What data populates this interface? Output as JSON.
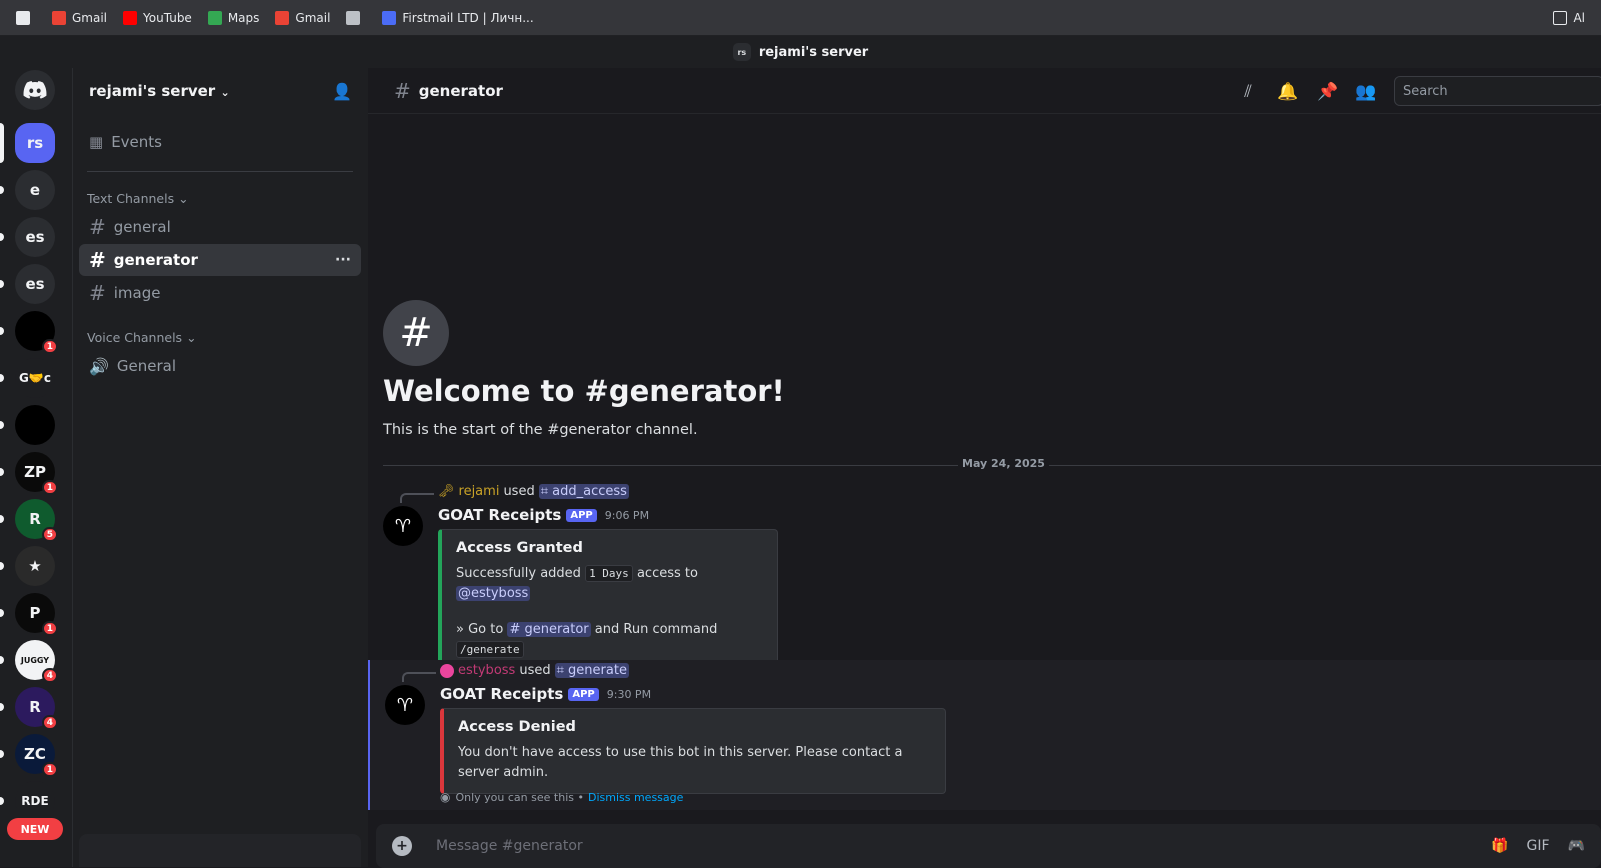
{
  "bookmarks": [
    {
      "label": "",
      "icon": "apps-grid-icon",
      "color": "#e8eaed"
    },
    {
      "label": "Gmail",
      "icon": "gmail-icon",
      "color": "#ea4335"
    },
    {
      "label": "YouTube",
      "icon": "youtube-icon",
      "color": "#ff0000"
    },
    {
      "label": "Maps",
      "icon": "maps-pin-icon",
      "color": "#34a853"
    },
    {
      "label": "Gmail",
      "icon": "gmail-icon",
      "color": "#ea4335"
    },
    {
      "label": "",
      "icon": "globe-icon",
      "color": "#bdc1c6"
    },
    {
      "label": "Firstmail LTD | Личн...",
      "icon": "firstmail-icon",
      "color": "#4b6cf5"
    }
  ],
  "bookmarks_right": "Al",
  "titlebar": {
    "icon_text": "rs",
    "title": "rejami's server"
  },
  "servers": [
    {
      "text": "rs",
      "color": "#5865f2",
      "active": true
    },
    {
      "text": "e",
      "color": "#2b2d31"
    },
    {
      "text": "es",
      "color": "#2b2d31"
    },
    {
      "text": "es",
      "color": "#2b2d31"
    },
    {
      "text": "",
      "color": "#000000",
      "badge": "1",
      "icon": "rept-supply-icon"
    },
    {
      "text": "G🤝c",
      "color": "#1e1f22",
      "icon": "goat-cook-icon"
    },
    {
      "text": "",
      "color": "#000000",
      "icon": "goat-icon"
    },
    {
      "text": "ZP",
      "color": "#0a0a0a",
      "badge": "1",
      "icon": "zp-icon"
    },
    {
      "text": "R",
      "color": "#0f5b2e",
      "badge": "5",
      "icon": "r-green-icon"
    },
    {
      "text": "★",
      "color": "#2a2a2a",
      "icon": "star-icon"
    },
    {
      "text": "P",
      "color": "#0a0a0a",
      "badge": "1",
      "icon": "p-purple-icon"
    },
    {
      "text": "JUGGY",
      "color": "#f2f3f5",
      "badge": "4",
      "icon": "juggy-icon"
    },
    {
      "text": "R",
      "color": "#2c1a5e",
      "badge": "4",
      "icon": "r-purple-icon"
    },
    {
      "text": "ZC",
      "color": "#0a1a3a",
      "badge": "1",
      "icon": "zc-icon"
    },
    {
      "text": "RDE",
      "color": "#1e1f22",
      "icon": "rde-icon"
    }
  ],
  "new_badge": "NEW",
  "sidebar": {
    "server_name": "rejami's server",
    "events": "Events",
    "text_cat": "Text Channels",
    "voice_cat": "Voice Channels",
    "channels": [
      "general",
      "generator",
      "image"
    ],
    "voice": [
      "General"
    ]
  },
  "header": {
    "channel": "generator",
    "search_placeholder": "Search"
  },
  "welcome": {
    "title": "Welcome to #generator!",
    "subtitle": "This is the start of the #generator channel.",
    "date": "May 24, 2025"
  },
  "messages": [
    {
      "ref_user": "rejami",
      "ref_used": "used",
      "ref_cmd": "add_access",
      "author": "GOAT Receipts",
      "tag": "APP",
      "time": "9:06 PM",
      "embed_title": "Access Granted",
      "embed_color": "#23a55a",
      "line1_pre": "Successfully added",
      "line1_code": "1 Days",
      "line1_mid": "access to",
      "line1_mention": "@estyboss",
      "line2_pre": "» Go to",
      "line2_channel": "# generator",
      "line2_mid": "and Run command",
      "line2_code": "/generate"
    },
    {
      "ref_user": "estyboss",
      "ref_used": "used",
      "ref_cmd": "generate",
      "author": "GOAT Receipts",
      "tag": "APP",
      "time": "9:30 PM",
      "embed_title": "Access Denied",
      "embed_color": "#da373c",
      "embed_desc": "You don't have access to use this bot in this server. Please contact a server admin.",
      "eph_text": "Only you can see this •",
      "eph_dismiss": "Dismiss message"
    }
  ],
  "composer_placeholder": "Message #generator"
}
